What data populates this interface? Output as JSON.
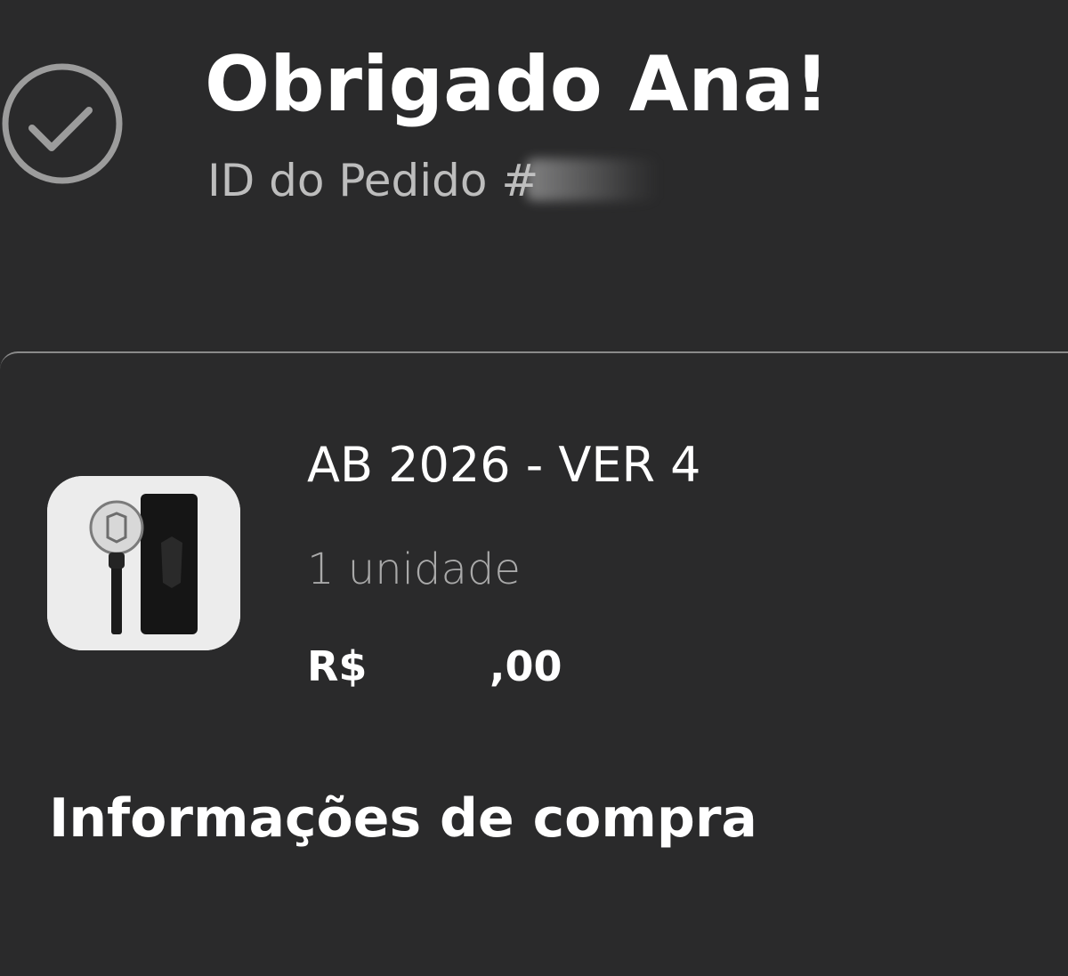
{
  "header": {
    "status_icon": "check-circle-icon",
    "title": "Obrigado Ana!",
    "order_id_prefix": "ID do Pedido #"
  },
  "order_item": {
    "thumbnail_icon": "lightstick-product-image",
    "name": "AB 2026 - VER 4",
    "quantity": "1 unidade",
    "price_currency": "R$",
    "price_visible_fragment": ",00"
  },
  "purchase_info": {
    "title": "Informações de compra"
  },
  "colors": {
    "background": "#2a2a2b",
    "text_primary": "#ffffff",
    "text_secondary": "#bdbdbd",
    "divider": "#8a8a8a"
  }
}
